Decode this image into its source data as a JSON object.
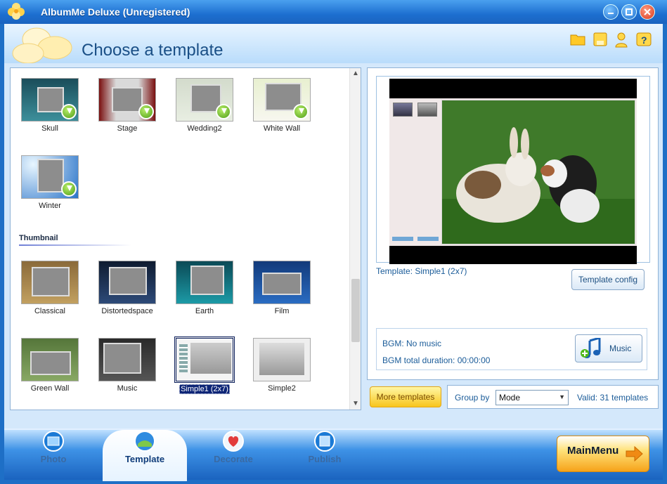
{
  "window": {
    "title": "AlbumMe Deluxe (Unregistered)"
  },
  "header": {
    "title": "Choose a template"
  },
  "templates": {
    "downloadable": [
      {
        "label": "Skull",
        "bg": "#24606d"
      },
      {
        "label": "Stage",
        "bg": "#6a1c1c"
      },
      {
        "label": "Wedding2",
        "bg": "#d9dfd2"
      },
      {
        "label": "White Wall",
        "bg": "#e9f0d6"
      },
      {
        "label": "Winter",
        "bg": "#2e7ccf"
      }
    ],
    "section_title": "Thumbnail",
    "thumbnail": [
      {
        "label": "Classical",
        "bg": "#5a4a2c"
      },
      {
        "label": "Distortedspace",
        "bg": "#1b2a44"
      },
      {
        "label": "Earth",
        "bg": "#0e6a74"
      },
      {
        "label": "Film",
        "bg": "#1c4c9a"
      },
      {
        "label": "Green Wall",
        "bg": "#6d8e4a"
      },
      {
        "label": "Music",
        "bg": "#3a3a3a"
      },
      {
        "label": "Simple1 (2x7)",
        "bg": "#f2f2f2",
        "selected": true
      },
      {
        "label": "Simple2",
        "bg": "#f2f2f2"
      }
    ]
  },
  "preview": {
    "template_label": "Template:  Simple1 (2x7)",
    "template_config_label": "Template config",
    "bgm": "BGM: No music",
    "bgm_duration": "BGM total duration: 00:00:00",
    "music_label": "Music"
  },
  "footer": {
    "more_templates_label": "More templates",
    "group_by_label": "Group by",
    "group_by_value": "Mode",
    "valid_count": "Valid: 31 templates"
  },
  "nav": {
    "tabs": [
      {
        "label": "Photo"
      },
      {
        "label": "Template"
      },
      {
        "label": "Decorate"
      },
      {
        "label": "Publish"
      }
    ],
    "mainmenu_label": "MainMenu"
  }
}
